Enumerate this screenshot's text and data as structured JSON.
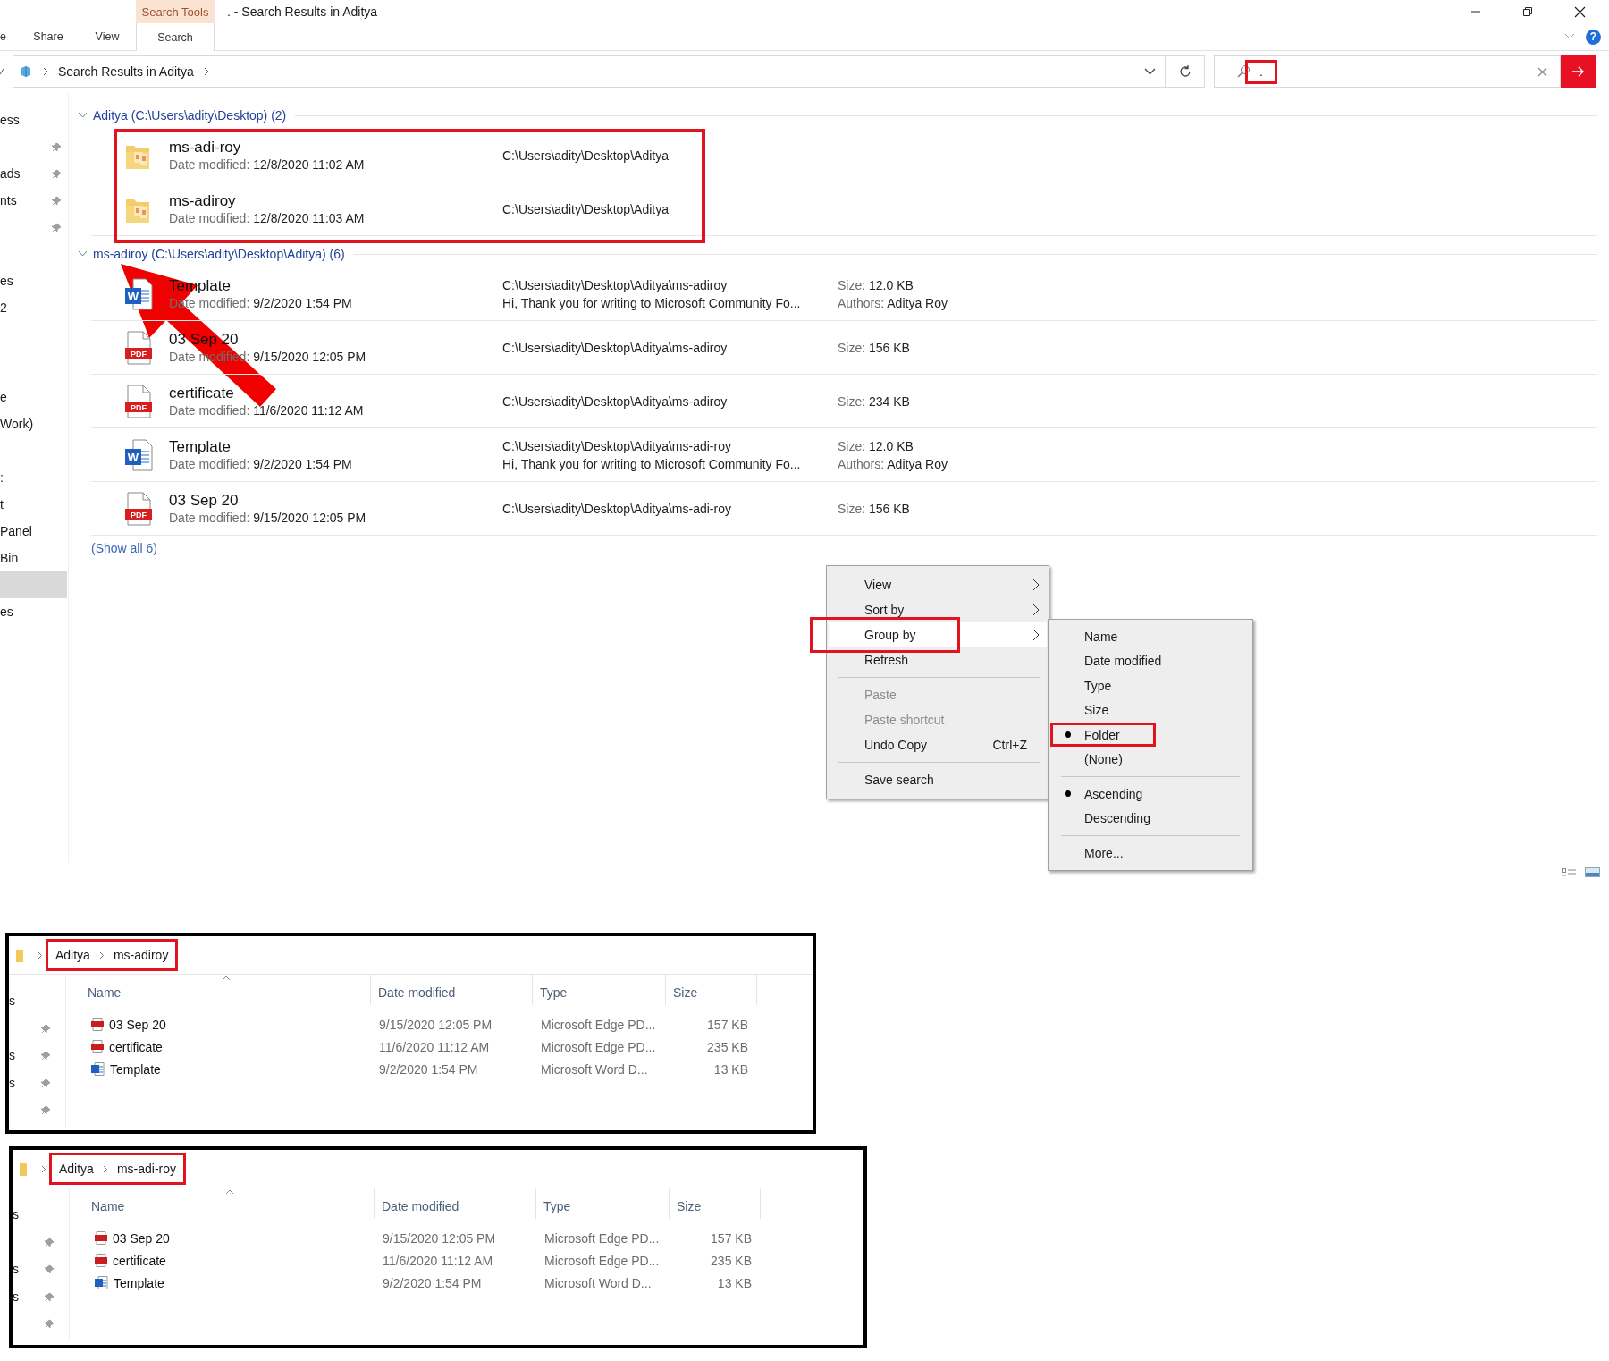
{
  "window": {
    "title": ". - Search Results in Aditya"
  },
  "ribbon": {
    "context_group": "Search Tools",
    "help": "?",
    "tabs": [
      {
        "label": "e",
        "selected": false
      },
      {
        "label": "Share",
        "selected": false
      },
      {
        "label": "View",
        "selected": false
      },
      {
        "label": "Search",
        "selected": true
      }
    ]
  },
  "address_bar": {
    "location": "Search Results in Aditya"
  },
  "search": {
    "value": ".",
    "marked": true
  },
  "nav_pane": {
    "sections": [
      {
        "items": [
          {
            "label": "ess",
            "pinned": false,
            "selected": false
          },
          {
            "pinned": true,
            "selected": false
          },
          {
            "label": "ads",
            "pinned": true,
            "selected": false
          },
          {
            "label": "nts",
            "pinned": true,
            "selected": false
          },
          {
            "pinned": true,
            "selected": false
          }
        ]
      },
      {
        "items": [
          {
            "label": "es",
            "pinned": false,
            "selected": false
          },
          {
            "label": "2",
            "pinned": false,
            "selected": false
          }
        ]
      },
      {
        "items": [
          {
            "label": "e",
            "pinned": false,
            "selected": false
          },
          {
            "label": "Work)",
            "pinned": false,
            "selected": false
          }
        ]
      },
      {
        "items": [
          {
            "label": ":",
            "pinned": false,
            "selected": false
          },
          {
            "label": "t",
            "pinned": false,
            "selected": false
          },
          {
            "label": "Panel",
            "pinned": false,
            "selected": false
          },
          {
            "label": "Bin",
            "pinned": false,
            "selected": false
          },
          {
            "pinned": false,
            "selected": true
          },
          {
            "label": "es",
            "pinned": false,
            "selected": false
          }
        ]
      }
    ]
  },
  "results": {
    "show_all": "(Show all 6)",
    "groups": [
      {
        "title": "Aditya (C:\\Users\\adity\\Desktop) (2)",
        "expanded": true,
        "marked": true,
        "items": [
          {
            "kind": "folder",
            "name": "ms-adi-roy",
            "date_label": "Date modified:",
            "date": "12/8/2020 11:02 AM",
            "path": "C:\\Users\\adity\\Desktop\\Aditya"
          },
          {
            "kind": "folder",
            "name": "ms-adiroy",
            "date_label": "Date modified:",
            "date": "12/8/2020 11:03 AM",
            "path": "C:\\Users\\adity\\Desktop\\Aditya"
          }
        ]
      },
      {
        "title": "ms-adiroy (C:\\Users\\adity\\Desktop\\Aditya) (6)",
        "expanded": true,
        "marked": false,
        "items": [
          {
            "kind": "word",
            "icon_text": "W",
            "name": "Template",
            "date_label": "Date modified:",
            "date": "9/2/2020 1:54 PM",
            "path": "C:\\Users\\adity\\Desktop\\Aditya\\ms-adiroy",
            "description": "Hi, Thank you for writing to Microsoft Community Fo...",
            "size_label": "Size:",
            "size": "12.0 KB",
            "authors_label": "Authors:",
            "authors": "Aditya Roy"
          },
          {
            "kind": "pdf",
            "icon_text": "PDF",
            "name": "03 Sep 20",
            "date_label": "Date modified:",
            "date": "9/15/2020 12:05 PM",
            "path": "C:\\Users\\adity\\Desktop\\Aditya\\ms-adiroy",
            "size_label": "Size:",
            "size": "156 KB"
          },
          {
            "kind": "pdf",
            "icon_text": "PDF",
            "name": "certificate",
            "date_label": "Date modified:",
            "date": "11/6/2020 11:12 AM",
            "path": "C:\\Users\\adity\\Desktop\\Aditya\\ms-adiroy",
            "size_label": "Size:",
            "size": "234 KB"
          },
          {
            "kind": "word",
            "icon_text": "W",
            "name": "Template",
            "date_label": "Date modified:",
            "date": "9/2/2020 1:54 PM",
            "path": "C:\\Users\\adity\\Desktop\\Aditya\\ms-adi-roy",
            "description": "Hi, Thank you for writing to Microsoft Community Fo...",
            "size_label": "Size:",
            "size": "12.0 KB",
            "authors_label": "Authors:",
            "authors": "Aditya Roy"
          },
          {
            "kind": "pdf",
            "icon_text": "PDF",
            "name": "03 Sep 20",
            "date_label": "Date modified:",
            "date": "9/15/2020 12:05 PM",
            "path": "C:\\Users\\adity\\Desktop\\Aditya\\ms-adi-roy",
            "size_label": "Size:",
            "size": "156 KB"
          }
        ]
      }
    ]
  },
  "context_menu": {
    "items": [
      {
        "kind": "item",
        "label": "View",
        "submenu": true,
        "disabled": false,
        "highlighted": false,
        "marked": false
      },
      {
        "kind": "item",
        "label": "Sort by",
        "submenu": true,
        "disabled": false,
        "highlighted": false,
        "marked": false
      },
      {
        "kind": "item",
        "label": "Group by",
        "submenu": true,
        "disabled": false,
        "highlighted": true,
        "marked": true
      },
      {
        "kind": "item",
        "label": "Refresh",
        "submenu": false,
        "disabled": false,
        "highlighted": false,
        "marked": false
      },
      {
        "kind": "separator"
      },
      {
        "kind": "item",
        "label": "Paste",
        "submenu": false,
        "disabled": true,
        "highlighted": false,
        "marked": false
      },
      {
        "kind": "item",
        "label": "Paste shortcut",
        "submenu": false,
        "disabled": true,
        "highlighted": false,
        "marked": false
      },
      {
        "kind": "item",
        "label": "Undo Copy",
        "shortcut": "Ctrl+Z",
        "submenu": false,
        "disabled": false,
        "highlighted": false,
        "marked": false
      },
      {
        "kind": "separator"
      },
      {
        "kind": "item",
        "label": "Save search",
        "submenu": false,
        "disabled": false,
        "highlighted": false,
        "marked": false
      }
    ]
  },
  "context_submenu": {
    "items": [
      {
        "kind": "item",
        "label": "Name",
        "checked": false,
        "marked": false
      },
      {
        "kind": "item",
        "label": "Date modified",
        "checked": false,
        "marked": false
      },
      {
        "kind": "item",
        "label": "Type",
        "checked": false,
        "marked": false
      },
      {
        "kind": "item",
        "label": "Size",
        "checked": false,
        "marked": false
      },
      {
        "kind": "item",
        "label": "Folder",
        "checked": true,
        "marked": true
      },
      {
        "kind": "item",
        "label": "(None)",
        "checked": false,
        "marked": false
      },
      {
        "kind": "separator"
      },
      {
        "kind": "item",
        "label": "Ascending",
        "checked": true,
        "marked": false
      },
      {
        "kind": "item",
        "label": "Descending",
        "checked": false,
        "marked": false
      },
      {
        "kind": "separator"
      },
      {
        "kind": "item",
        "label": "More...",
        "checked": false,
        "marked": false
      }
    ]
  },
  "folder_views": [
    {
      "crumbs": [
        "Aditya",
        "ms-adiroy"
      ],
      "marked": true,
      "columns": [
        {
          "label": "Name",
          "sorted": true
        },
        {
          "label": "Date modified",
          "sorted": false
        },
        {
          "label": "Type",
          "sorted": false
        },
        {
          "label": "Size",
          "sorted": false
        }
      ],
      "nav": [
        {
          "label": "s",
          "pinned": false
        },
        {
          "pinned": true
        },
        {
          "label": "s",
          "pinned": true
        },
        {
          "label": "s",
          "pinned": true
        },
        {
          "pinned": true
        }
      ],
      "rows": [
        {
          "kind": "pdf",
          "name": "03 Sep 20",
          "date": "9/15/2020 12:05 PM",
          "type": "Microsoft Edge PD...",
          "size": "157 KB"
        },
        {
          "kind": "pdf",
          "name": "certificate",
          "date": "11/6/2020 11:12 AM",
          "type": "Microsoft Edge PD...",
          "size": "235 KB"
        },
        {
          "kind": "word",
          "name": "Template",
          "date": "9/2/2020 1:54 PM",
          "type": "Microsoft Word D...",
          "size": "13 KB"
        }
      ]
    },
    {
      "crumbs": [
        "Aditya",
        "ms-adi-roy"
      ],
      "marked": true,
      "columns": [
        {
          "label": "Name",
          "sorted": true
        },
        {
          "label": "Date modified",
          "sorted": false
        },
        {
          "label": "Type",
          "sorted": false
        },
        {
          "label": "Size",
          "sorted": false
        }
      ],
      "nav": [
        {
          "label": "s",
          "pinned": false
        },
        {
          "pinned": true
        },
        {
          "label": "s",
          "pinned": true
        },
        {
          "label": "s",
          "pinned": true
        },
        {
          "pinned": true
        }
      ],
      "rows": [
        {
          "kind": "pdf",
          "name": "03 Sep 20",
          "date": "9/15/2020 12:05 PM",
          "type": "Microsoft Edge PD...",
          "size": "157 KB"
        },
        {
          "kind": "pdf",
          "name": "certificate",
          "date": "11/6/2020 11:12 AM",
          "type": "Microsoft Edge PD...",
          "size": "235 KB"
        },
        {
          "kind": "word",
          "name": "Template",
          "date": "9/2/2020 1:54 PM",
          "type": "Microsoft Word D...",
          "size": "13 KB"
        }
      ]
    }
  ]
}
